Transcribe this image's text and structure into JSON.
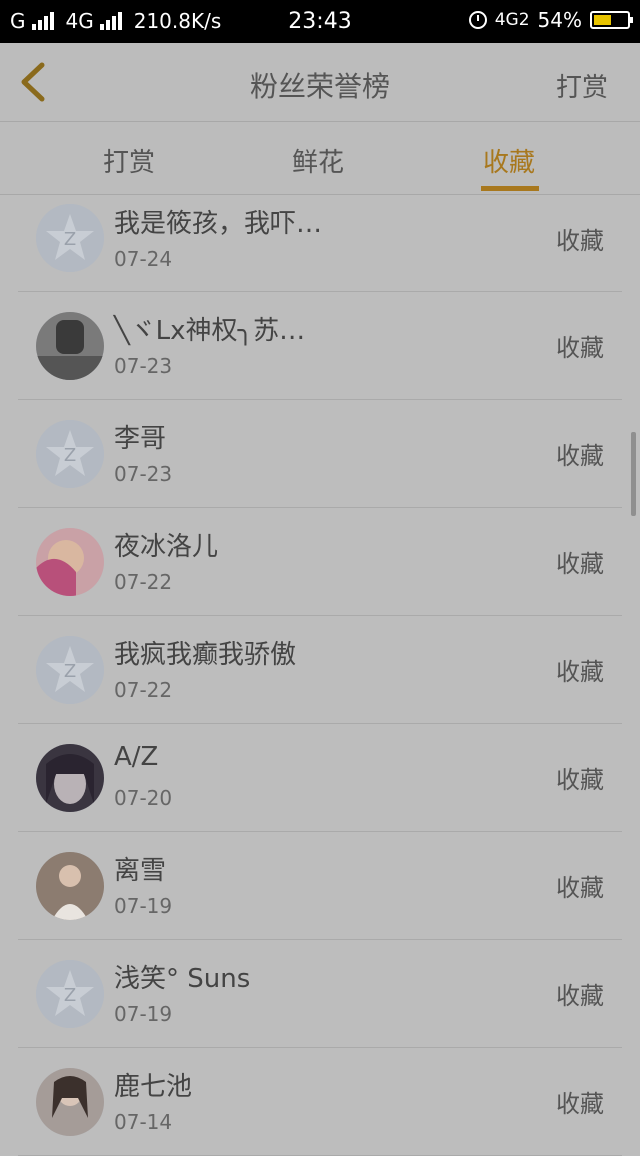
{
  "status_bar": {
    "carrier1": "G",
    "carrier2": "4G",
    "speed": "210.8K/s",
    "time": "23:43",
    "network": "4G2",
    "battery": "54%",
    "battery_level": 0.54
  },
  "header": {
    "title": "粉丝荣誉榜",
    "right_label": "打赏",
    "back_icon": "chevron-left-icon"
  },
  "tabs": [
    {
      "label": "打赏",
      "active": false
    },
    {
      "label": "鲜花",
      "active": false
    },
    {
      "label": "收藏",
      "active": true
    }
  ],
  "colors": {
    "accent": "#a8781e",
    "overlay_bg": "#bdbdbd"
  },
  "fans": [
    {
      "name": "我是筱孩，我吓…",
      "date": "07-24",
      "action": "收藏",
      "avatar": "default-star-avatar"
    },
    {
      "name": "╲ヾLx神权╮苏…",
      "date": "07-23",
      "action": "收藏",
      "avatar": "photo-avatar-dark"
    },
    {
      "name": "李哥",
      "date": "07-23",
      "action": "收藏",
      "avatar": "default-star-avatar"
    },
    {
      "name": "夜冰洛儿",
      "date": "07-22",
      "action": "收藏",
      "avatar": "photo-avatar-pink"
    },
    {
      "name": "我疯我癫我骄傲",
      "date": "07-22",
      "action": "收藏",
      "avatar": "default-star-avatar"
    },
    {
      "name": "A/Z",
      "date": "07-20",
      "action": "收藏",
      "avatar": "photo-avatar-anime"
    },
    {
      "name": "离雪",
      "date": "07-19",
      "action": "收藏",
      "avatar": "photo-avatar-girl"
    },
    {
      "name": "浅笑° Suns",
      "date": "07-19",
      "action": "收藏",
      "avatar": "default-star-avatar"
    },
    {
      "name": "鹿七池",
      "date": "07-14",
      "action": "收藏",
      "avatar": "photo-avatar-girl2"
    }
  ]
}
